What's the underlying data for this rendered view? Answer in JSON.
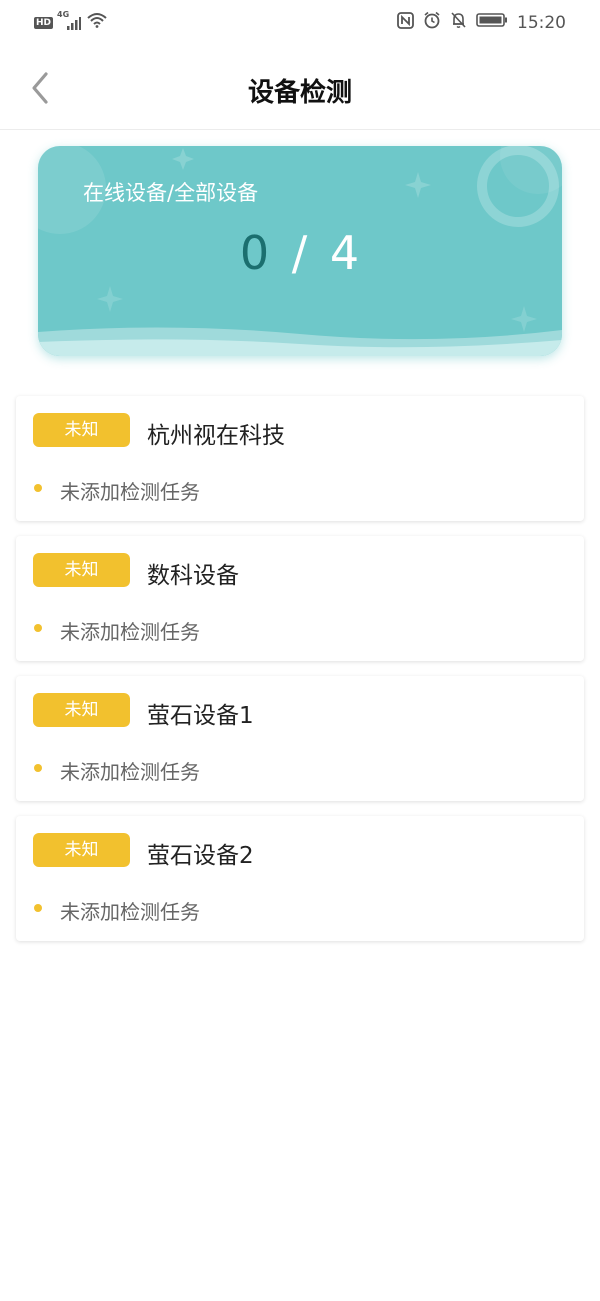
{
  "status_bar": {
    "hd_label": "HD",
    "network_label": "4G",
    "time": "15:20"
  },
  "header": {
    "title": "设备检测"
  },
  "summary": {
    "label": "在线设备/全部设备",
    "online": "0",
    "separator": "/",
    "total": "4"
  },
  "devices": [
    {
      "status": "未知",
      "name": "杭州视在科技",
      "task": "未添加检测任务"
    },
    {
      "status": "未知",
      "name": "数科设备",
      "task": "未添加检测任务"
    },
    {
      "status": "未知",
      "name": "萤石设备1",
      "task": "未添加检测任务"
    },
    {
      "status": "未知",
      "name": "萤石设备2",
      "task": "未添加检测任务"
    }
  ],
  "colors": {
    "accent_teal": "#6ec8c9",
    "online_count": "#1b6f6f",
    "badge_yellow": "#f2c12e"
  }
}
